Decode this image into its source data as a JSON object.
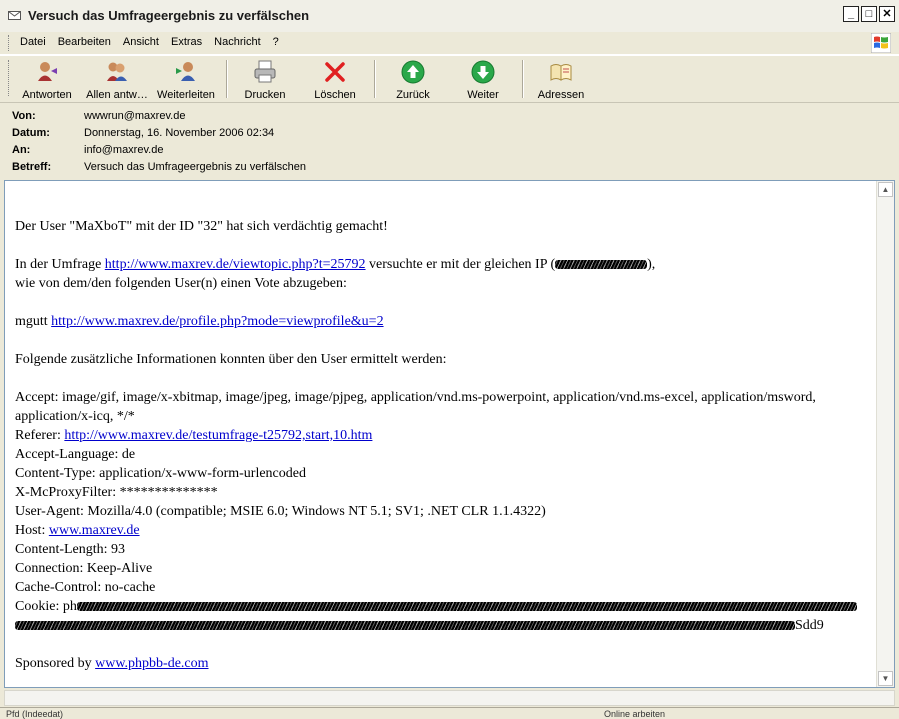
{
  "window": {
    "title": "Versuch das Umfrageergebnis zu verfälschen"
  },
  "menu": [
    "Datei",
    "Bearbeiten",
    "Ansicht",
    "Extras",
    "Nachricht",
    "?"
  ],
  "toolbar": {
    "reply": "Antworten",
    "reply_all": "Allen antw…",
    "forward": "Weiterleiten",
    "print": "Drucken",
    "delete": "Löschen",
    "back": "Zurück",
    "next": "Weiter",
    "addresses": "Adressen"
  },
  "headers": {
    "from_label": "Von:",
    "from": "wwwrun@maxrev.de",
    "date_label": "Datum:",
    "date": "Donnerstag, 16. November 2006 02:34",
    "to_label": "An:",
    "to": "info@maxrev.de",
    "subject_label": "Betreff:",
    "subject": "Versuch das Umfrageergebnis zu verfälschen"
  },
  "message": {
    "line1": "Der User \"MaXboT\" mit der ID \"32\" hat sich verdächtig gemacht!",
    "poll_prefix": "In der Umfrage ",
    "poll_link": "http://www.maxrev.de/viewtopic.php?t=25792",
    "poll_suffix": " versuchte er mit der gleichen IP (",
    "poll_ip_tail": "),",
    "poll_line2": "wie von dem/den folgenden User(n) einen Vote abzugeben:",
    "user_name": "mgutt ",
    "user_link": "http://www.maxrev.de/profile.php?mode=viewprofile&u=2",
    "info_line": "Folgende zusätzliche Informationen konnten über den User ermittelt werden:",
    "accept": "Accept: image/gif, image/x-xbitmap, image/jpeg, image/pjpeg, application/vnd.ms-powerpoint, application/vnd.ms-excel, application/msword, application/x-icq, */*",
    "referer_label": "Referer: ",
    "referer_link": "http://www.maxrev.de/testumfrage-t25792,start,10.htm",
    "accept_language": "Accept-Language: de",
    "content_type": "Content-Type: application/x-www-form-urlencoded",
    "proxy_filter": "X-McProxyFilter: **************",
    "user_agent": "User-Agent: Mozilla/4.0 (compatible; MSIE 6.0; Windows NT 5.1; SV1; .NET CLR 1.1.4322)",
    "host_label": "Host: ",
    "host_link": "www.maxrev.de",
    "content_length": "Content-Length: 93",
    "connection": "Connection: Keep-Alive",
    "cache_control": "Cache-Control: no-cache",
    "cookie_label": "Cookie: ph",
    "cookie_tail": "Sdd9",
    "sponsored_label": "Sponsored by ",
    "sponsored_link": "www.phpbb-de.com"
  },
  "status": {
    "left": "Pfd (Indeedat)",
    "right": "Online arbeiten"
  },
  "colors": {
    "link": "#0000cc",
    "chrome": "#ece9d8",
    "border": "#7f9db9"
  }
}
